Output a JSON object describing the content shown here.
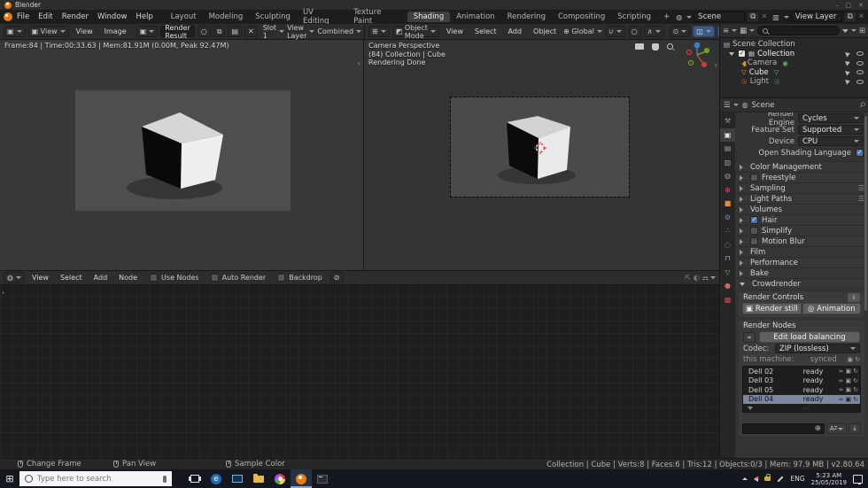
{
  "window": {
    "title": "Blender"
  },
  "menubar": {
    "menus": [
      "File",
      "Edit",
      "Render",
      "Window",
      "Help"
    ],
    "workspaces": [
      "Layout",
      "Modeling",
      "Sculpting",
      "UV Editing",
      "Texture Paint",
      "Shading",
      "Animation",
      "Rendering",
      "Compositing",
      "Scripting"
    ],
    "active_workspace": "Shading",
    "add_workspace": "+",
    "scene_selector": "Scene",
    "view_layer_selector": "View Layer"
  },
  "image_editor": {
    "mode": "View",
    "menus": [
      "View",
      "Image"
    ],
    "image_name": "Render Result",
    "slot": "Slot 1",
    "layer": "View Layer",
    "pass": "Combined",
    "overlay": "Frame:84 | Time:00:33.63 | Mem:81.91M (0.00M, Peak 92.47M)"
  },
  "viewport": {
    "mode": "Object Mode",
    "menus": [
      "View",
      "Select",
      "Add",
      "Object"
    ],
    "orientation": "Global",
    "overlay": [
      "Camera Perspective",
      "(84) Collection | Cube",
      "Rendering Done"
    ]
  },
  "node_editor": {
    "menus": [
      "View",
      "Select",
      "Add",
      "Node"
    ],
    "toggles": [
      "Use Nodes",
      "Auto Render",
      "Backdrop"
    ]
  },
  "outliner": {
    "rows": [
      {
        "label": "Scene Collection"
      },
      {
        "label": "Collection",
        "checked": true
      },
      {
        "label": "Camera"
      },
      {
        "label": "Cube"
      },
      {
        "label": "Light"
      }
    ]
  },
  "properties": {
    "breadcrumb": "Scene",
    "fields": [
      {
        "label": "Render Engine",
        "value": "Cycles"
      },
      {
        "label": "Feature Set",
        "value": "Supported"
      },
      {
        "label": "Device",
        "value": "CPU"
      }
    ],
    "osl_label": "Open Shading Language",
    "osl_checked": true,
    "panels": [
      {
        "label": "Color Management"
      },
      {
        "label": "Freestyle",
        "checkbox": false
      },
      {
        "label": "Sampling",
        "preset": true
      },
      {
        "label": "Light Paths",
        "preset": true
      },
      {
        "label": "Volumes"
      },
      {
        "label": "Hair",
        "checkbox": true
      },
      {
        "label": "Simplify",
        "checkbox": false
      },
      {
        "label": "Motion Blur",
        "checkbox": false
      },
      {
        "label": "Film"
      },
      {
        "label": "Performance"
      },
      {
        "label": "Bake"
      },
      {
        "label": "Crowdrender",
        "expanded": true
      }
    ],
    "crowdrender": {
      "render_controls_label": "Render Controls",
      "render_still_label": "Render still",
      "animation_label": "Animation",
      "render_nodes_label": "Render Nodes",
      "edit_load_balancing_label": "Edit load balancing",
      "codec_label": "Codec:",
      "codec_value": "ZIP (lossless)",
      "machine_label": "this machine:",
      "machine_status": "synced",
      "nodes": [
        {
          "name": "Dell 02",
          "status": "ready"
        },
        {
          "name": "Dell 03",
          "status": "ready"
        },
        {
          "name": "Dell 05",
          "status": "ready"
        },
        {
          "name": "Dell 04",
          "status": "ready",
          "selected": true
        }
      ]
    }
  },
  "statusbar": {
    "hints": [
      "Change Frame",
      "Pan View",
      "Sample Color"
    ],
    "stats": "Collection | Cube | Verts:8 | Faces:6 | Tris:12 | Objects:0/3 | Mem: 97.9 MB | v2.80.64"
  },
  "taskbar": {
    "search_placeholder": "Type here to search",
    "language": "ENG",
    "time": "5:23 AM",
    "date": "25/05/2019"
  }
}
